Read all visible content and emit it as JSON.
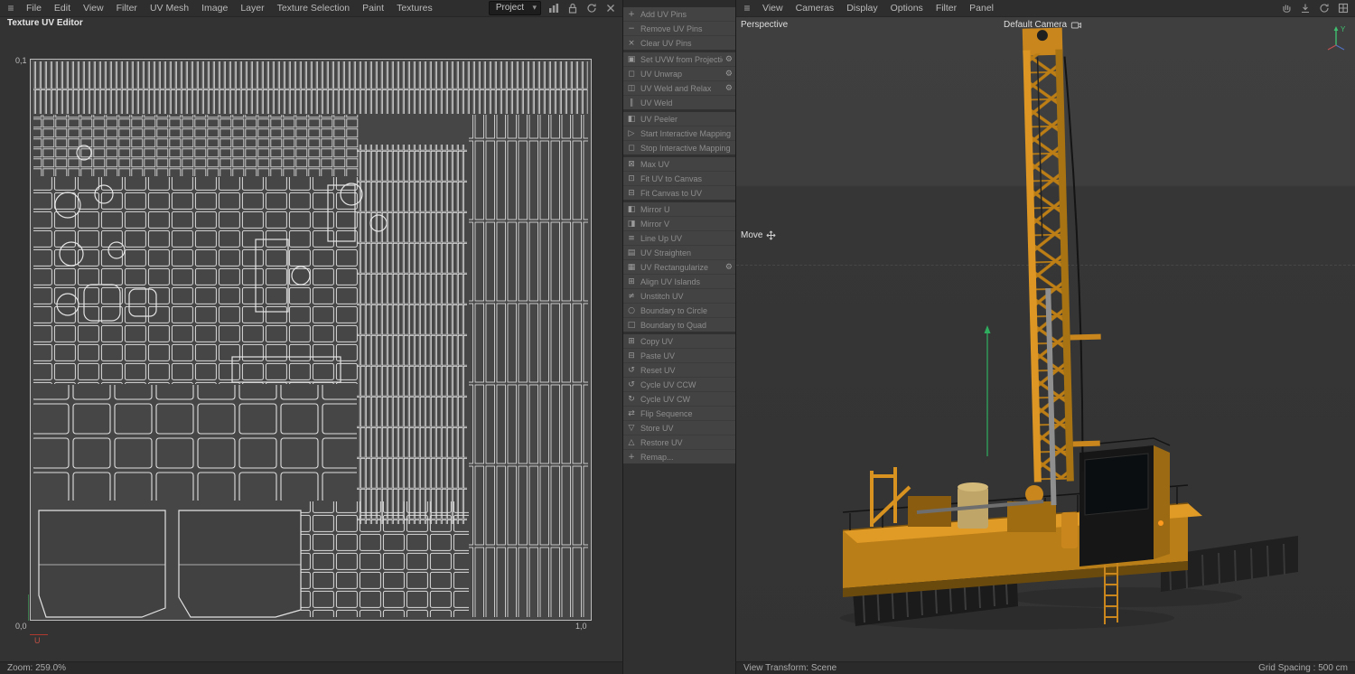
{
  "colors": {
    "accent_orange": "#d8921f",
    "panel_bg": "#434343",
    "canvas_bg": "#464646",
    "wireframe": "#dcdcdc",
    "axis_green": "#2fae5f",
    "axis_red": "#c05045"
  },
  "left": {
    "menu": [
      "File",
      "Edit",
      "View",
      "Filter",
      "UV Mesh",
      "Image",
      "Layer",
      "Texture Selection",
      "Paint",
      "Textures"
    ],
    "hamburger": "≡",
    "project_select": "Project",
    "title": "Texture UV Editor",
    "uv": {
      "top_left": "0,1",
      "bottom_left": "0,0",
      "bottom_right": "1,0",
      "u_axis": "U"
    },
    "status": "Zoom: 259.0%"
  },
  "commands": {
    "groups": [
      {
        "items": [
          {
            "label": "Add UV Pins",
            "icon": "+"
          },
          {
            "label": "Remove UV Pins",
            "icon": "−"
          },
          {
            "label": "Clear UV Pins",
            "icon": "×"
          }
        ]
      },
      {
        "items": [
          {
            "label": "Set UVW from Projection",
            "icon": "▣",
            "gear": "⚙"
          },
          {
            "label": "UV Unwrap",
            "icon": "◻",
            "gear": "⚙"
          },
          {
            "label": "UV Weld and Relax",
            "icon": "◫",
            "gear": "⚙"
          },
          {
            "label": "UV Weld",
            "icon": "∥"
          }
        ]
      },
      {
        "items": [
          {
            "label": "UV Peeler",
            "icon": "◧"
          },
          {
            "label": "Start Interactive Mapping",
            "icon": "▷"
          },
          {
            "label": "Stop Interactive Mapping",
            "icon": "◻"
          }
        ]
      },
      {
        "items": [
          {
            "label": "Max UV",
            "icon": "⊠"
          },
          {
            "label": "Fit UV to Canvas",
            "icon": "⊡"
          },
          {
            "label": "Fit Canvas to UV",
            "icon": "⊟"
          }
        ]
      },
      {
        "items": [
          {
            "label": "Mirror U",
            "icon": "◧"
          },
          {
            "label": "Mirror V",
            "icon": "◨"
          },
          {
            "label": "Line Up UV",
            "icon": "≡"
          },
          {
            "label": "UV Straighten",
            "icon": "▤"
          },
          {
            "label": "UV Rectangularize",
            "icon": "▦",
            "gear": "⚙"
          },
          {
            "label": "Align UV Islands",
            "icon": "⊞"
          },
          {
            "label": "Unstitch UV",
            "icon": "≠"
          },
          {
            "label": "Boundary to Circle",
            "icon": "○"
          },
          {
            "label": "Boundary to Quad",
            "icon": "□"
          }
        ]
      },
      {
        "items": [
          {
            "label": "Copy UV",
            "icon": "⊞"
          },
          {
            "label": "Paste UV",
            "icon": "⊟"
          },
          {
            "label": "Reset UV",
            "icon": "↺"
          },
          {
            "label": "Cycle UV CCW",
            "icon": "↺"
          },
          {
            "label": "Cycle UV CW",
            "icon": "↻"
          },
          {
            "label": "Flip Sequence",
            "icon": "⇄"
          },
          {
            "label": "Store UV",
            "icon": "▽"
          },
          {
            "label": "Restore UV",
            "icon": "△"
          },
          {
            "label": "Remap...",
            "icon": "+"
          }
        ]
      }
    ]
  },
  "viewport": {
    "hamburger": "≡",
    "menu": [
      "View",
      "Cameras",
      "Display",
      "Options",
      "Filter",
      "Panel"
    ],
    "view_label": "Perspective",
    "camera_label": "Default Camera",
    "tool_label": "Move",
    "status_left": "View Transform: Scene",
    "status_right": "Grid Spacing : 500 cm",
    "axis_y": "Y"
  }
}
